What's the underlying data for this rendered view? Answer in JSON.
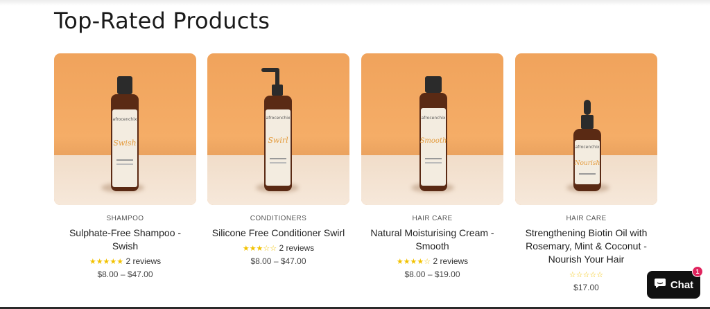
{
  "section": {
    "title": "Top-Rated Products"
  },
  "products": [
    {
      "category": "SHAMPOO",
      "name": "Sulphate-Free Shampoo - Swish",
      "stars": "★★★★★",
      "reviews": "2 reviews",
      "price": "$8.00 – $47.00",
      "rating_value": 5,
      "label": "Swish"
    },
    {
      "category": "CONDITIONERS",
      "name": "Silicone Free Conditioner Swirl",
      "stars": "★★★☆☆",
      "reviews": "2 reviews",
      "price": "$8.00 – $47.00",
      "rating_value": 3,
      "label": "Swirl"
    },
    {
      "category": "HAIR CARE",
      "name": "Natural Moisturising Cream - Smooth",
      "stars": "★★★★☆",
      "reviews": "2 reviews",
      "price": "$8.00 – $19.00",
      "rating_value": 4,
      "label": "Smooth"
    },
    {
      "category": "HAIR CARE",
      "name": "Strengthening Biotin Oil with Rosemary, Mint & Coconut - Nourish Your Hair",
      "stars": "☆☆☆☆☆",
      "reviews": "",
      "price": "$17.00",
      "rating_value": 0,
      "label": "Nourish"
    }
  ],
  "chat": {
    "label": "Chat",
    "badge": "1",
    "icon": "chat-bubble-icon"
  },
  "colors": {
    "background_orange": "#f0a35c",
    "floor": "#f4e4d4",
    "star": "#f2c200",
    "chat_bg": "#111111",
    "badge": "#e0245e"
  }
}
